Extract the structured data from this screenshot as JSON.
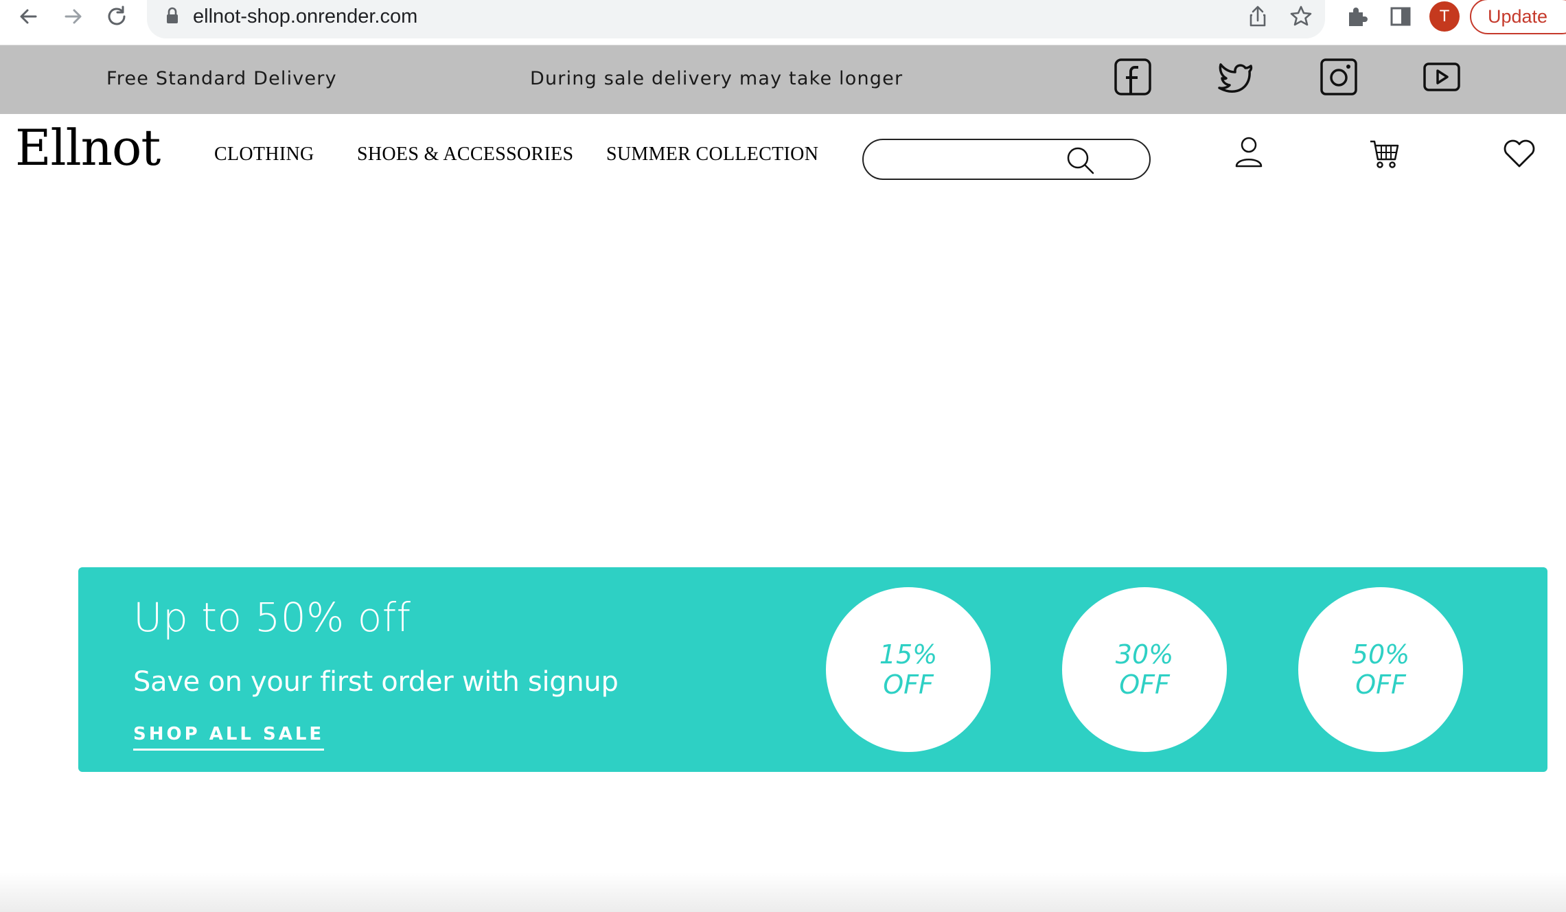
{
  "browser": {
    "url": "ellnot-shop.onrender.com",
    "profile_initial": "T",
    "update_label": "Update",
    "accent_color": "#c5392b"
  },
  "promo_bar": {
    "left_text": "Free Standard Delivery",
    "center_text": "During sale delivery may take longer",
    "social_icons": [
      "facebook-icon",
      "twitter-icon",
      "instagram-icon",
      "youtube-icon"
    ]
  },
  "header": {
    "logo": "Ellnot",
    "nav": [
      "CLOTHING",
      "SHOES & ACCESSORIES",
      "SUMMER COLLECTION"
    ],
    "search_value": "",
    "icons": [
      "user-icon",
      "cart-icon",
      "heart-icon"
    ]
  },
  "sale": {
    "title": "Up to 50% off",
    "subtitle": "Save on your first order with signup",
    "cta": "SHOP ALL SALE",
    "color": "#2ed0c4",
    "discounts": [
      {
        "percent": "15%",
        "label": "OFF"
      },
      {
        "percent": "30%",
        "label": "OFF"
      },
      {
        "percent": "50%",
        "label": "OFF"
      }
    ]
  }
}
